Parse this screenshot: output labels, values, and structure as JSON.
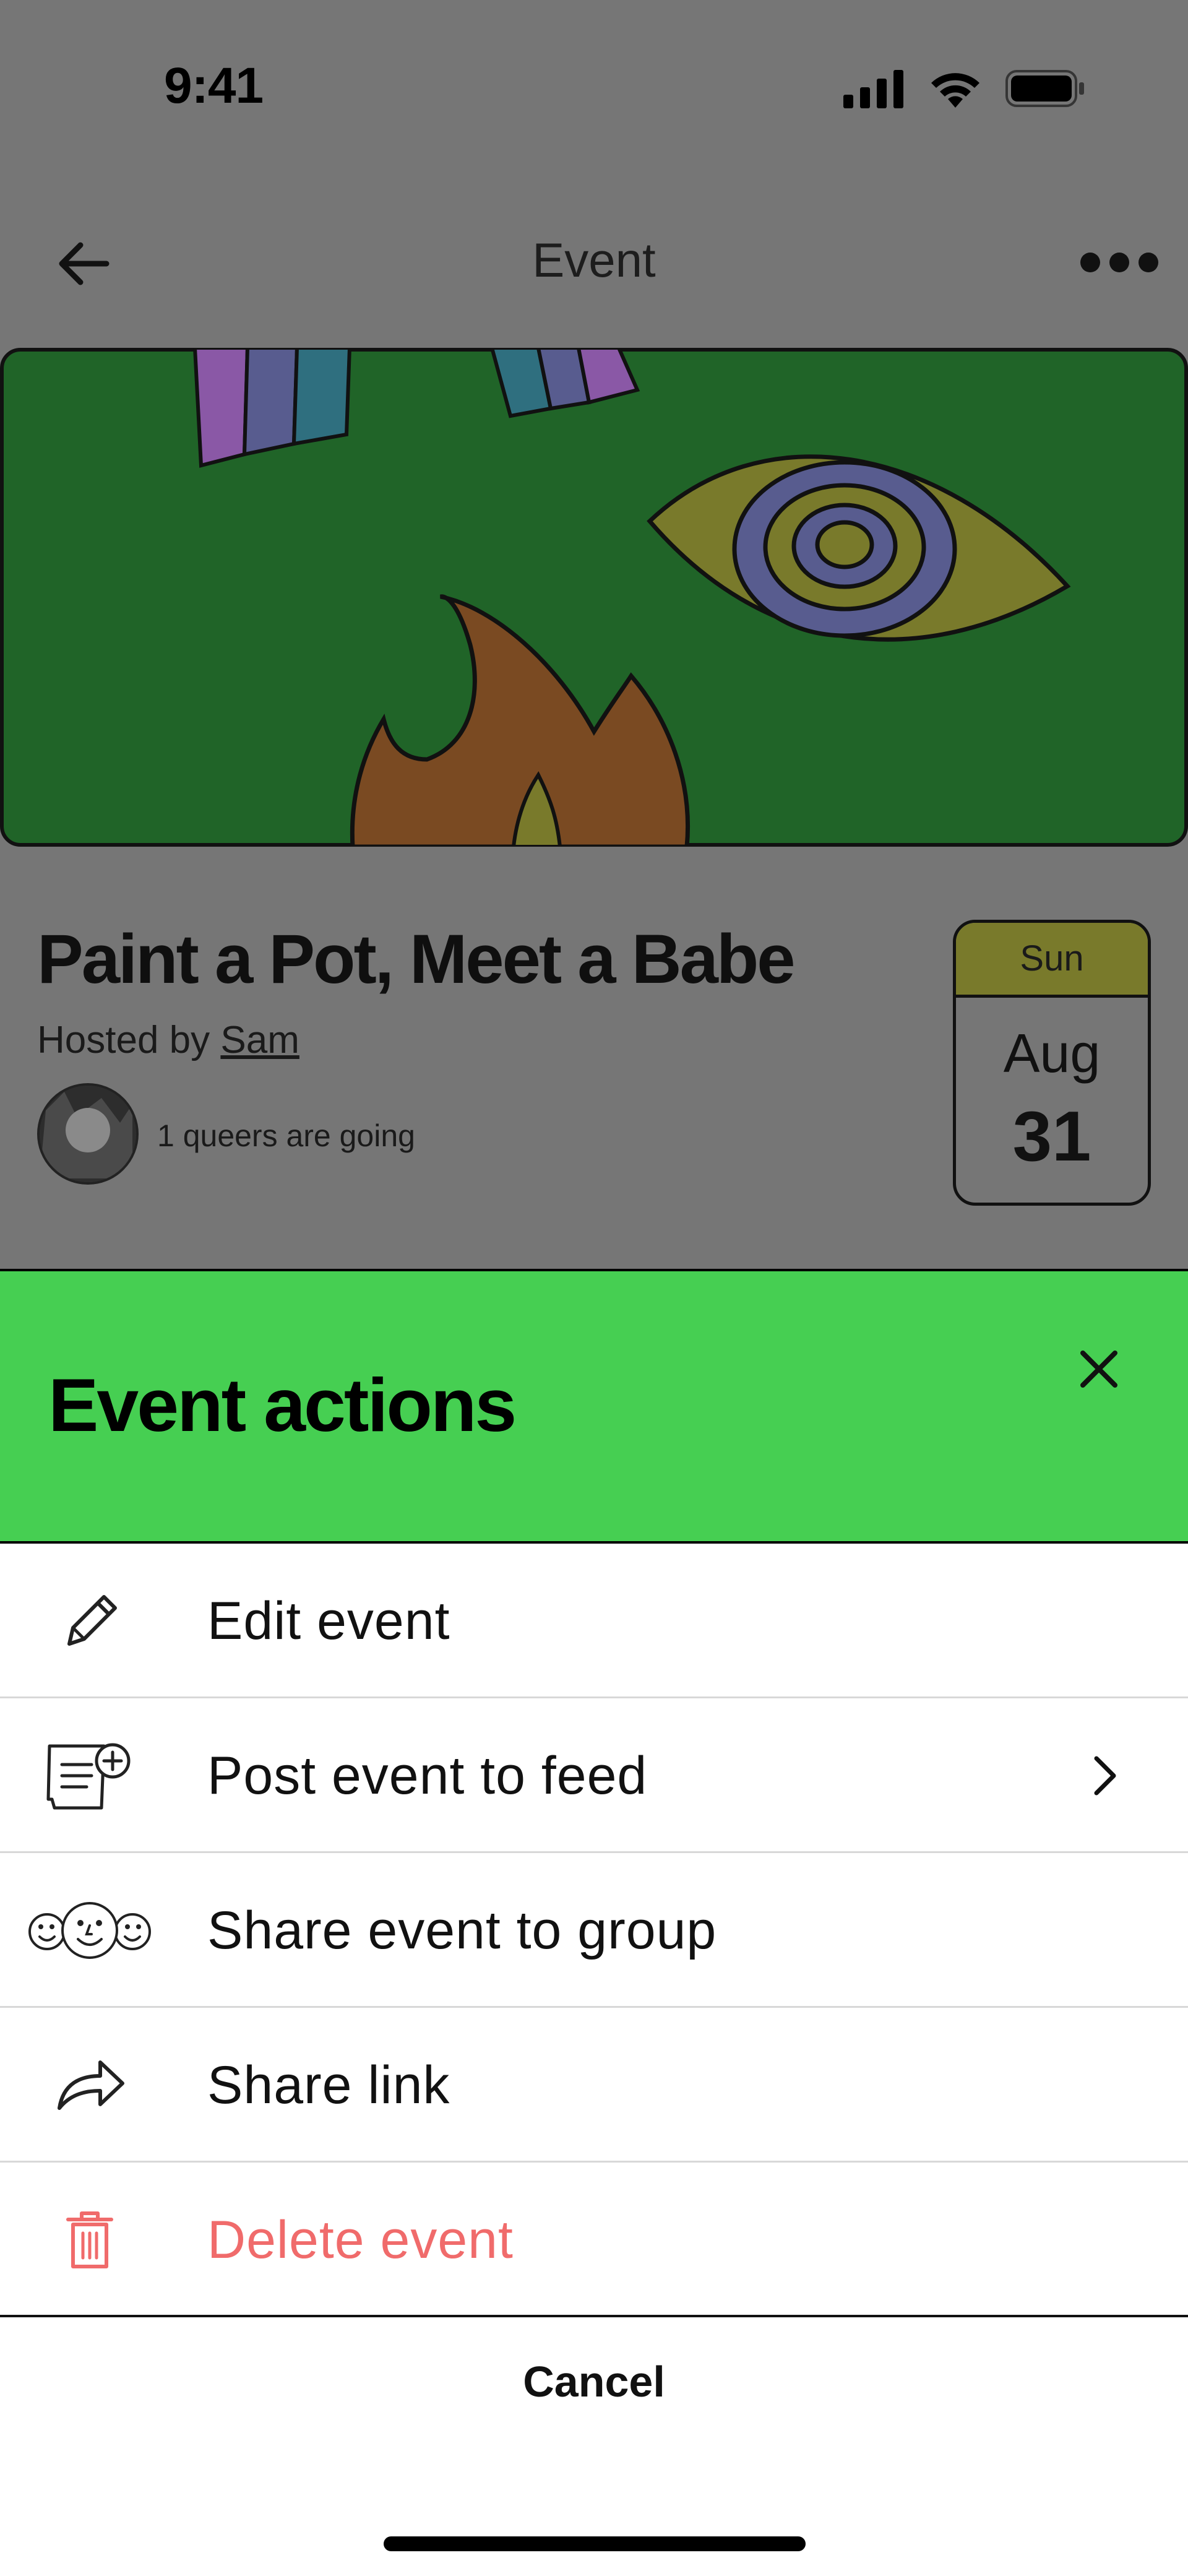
{
  "status_bar": {
    "time": "9:41"
  },
  "nav": {
    "title": "Event"
  },
  "event": {
    "title": "Paint a Pot, Meet a Babe",
    "hosted_prefix": "Hosted by ",
    "host": "Sam",
    "attendance": "1 queers are going",
    "date": {
      "day": "Sun",
      "month": "Aug",
      "date": "31"
    }
  },
  "sheet": {
    "title": "Event actions",
    "actions": [
      {
        "label": "Edit event",
        "icon": "pencil-icon"
      },
      {
        "label": "Post event to feed",
        "icon": "post-to-feed-icon",
        "has_chevron": true
      },
      {
        "label": "Share event to group",
        "icon": "group-faces-icon"
      },
      {
        "label": "Share link",
        "icon": "share-arrow-icon"
      },
      {
        "label": "Delete event",
        "icon": "trash-icon",
        "danger": true
      }
    ],
    "cancel_label": "Cancel"
  },
  "colors": {
    "overlay_bg": "#767676",
    "sheet_header": "#46cf52",
    "banner_green": "#206428",
    "danger": "#f06b6b",
    "date_header": "#797a2b"
  }
}
